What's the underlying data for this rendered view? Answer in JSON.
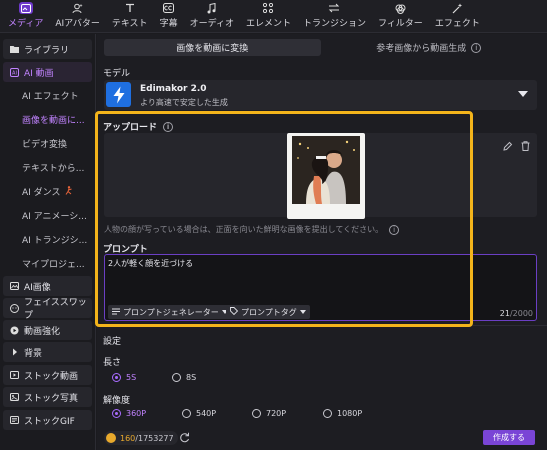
{
  "toolbar": {
    "items": [
      {
        "label": "メディア",
        "icon": "media-icon"
      },
      {
        "label": "AIアバター",
        "icon": "avatar-icon"
      },
      {
        "label": "テキスト",
        "icon": "text-icon"
      },
      {
        "label": "字幕",
        "icon": "subtitle-icon"
      },
      {
        "label": "オーディオ",
        "icon": "audio-icon"
      },
      {
        "label": "エレメント",
        "icon": "element-icon"
      },
      {
        "label": "トランジション",
        "icon": "transition-icon"
      },
      {
        "label": "フィルター",
        "icon": "filter-icon"
      },
      {
        "label": "エフェクト",
        "icon": "effect-icon"
      }
    ]
  },
  "sidebar": {
    "library": "ライブラリ",
    "ai_video": "AI 動画",
    "sub_items": [
      "AI エフェクト",
      "画像を動画に...",
      "ビデオ変換",
      "テキストから...",
      "AI ダンス",
      "AI アニメーシ...",
      "AI トランジシ...",
      "マイプロジェ..."
    ],
    "ai_image": "AI画像",
    "face_swap": "フェイススワップ",
    "video_enhance": "動画強化",
    "background": "背景",
    "stock_video": "ストック動画",
    "stock_photo": "ストック写真",
    "stock_gif": "ストックGIF"
  },
  "tabs": {
    "image_to_video": "画像を動画に変換",
    "reference_image": "参考画像から動画生成"
  },
  "model": {
    "section": "モデル",
    "name": "Edimakor 2.0",
    "desc": "より高速で安定した生成"
  },
  "upload": {
    "title": "アップロード",
    "hint": "人物の顔が写っている場合は、正面を向いた鮮明な画像を提出してください。"
  },
  "prompt": {
    "title": "プロンプト",
    "text": "2人が軽く顔を近づける",
    "generator": "プロンプトジェネレーター",
    "tags": "プロンプトタグ",
    "count": "21",
    "max": "/2000"
  },
  "settings": {
    "title": "設定",
    "length_label": "長さ",
    "lengths": [
      "5S",
      "8S"
    ],
    "resolution_label": "解像度",
    "resolutions": [
      "360P",
      "540P",
      "720P",
      "1080P"
    ]
  },
  "footer": {
    "credits_used": "160",
    "credits_total": "/1753277",
    "create": "作成する"
  },
  "colors": {
    "accent": "#a86bff",
    "highlight": "#f3b41b",
    "model_icon": "#1f6fe0",
    "create_button": "#7a45d6"
  }
}
